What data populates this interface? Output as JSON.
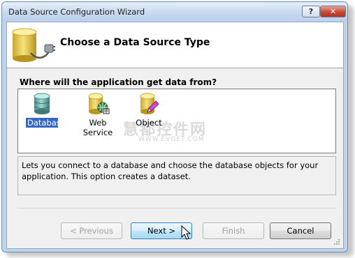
{
  "window": {
    "title": "Data Source Configuration Wizard"
  },
  "titlebar": {
    "help_label": "?",
    "close_label": "✕"
  },
  "header": {
    "title": "Choose a Data Source Type",
    "icon": "database-plug-icon"
  },
  "question": "Where will the application get data from?",
  "types": [
    {
      "label": "Database",
      "icon": "database-icon",
      "selected": true
    },
    {
      "label": "Web Service",
      "icon": "web-service-icon",
      "selected": false
    },
    {
      "label": "Object",
      "icon": "object-icon",
      "selected": false
    }
  ],
  "watermark": {
    "main": "慧都控件网",
    "sub": "WWW.EVGET.COM"
  },
  "description": "Lets you connect to a database and choose the database objects for your application. This option creates a dataset.",
  "buttons": {
    "previous": "< Previous",
    "next": "Next >",
    "finish": "Finish",
    "cancel": "Cancel"
  },
  "colors": {
    "selection": "#3168c6",
    "title_gradient_top": "#e4eefa",
    "close_red": "#c8493a"
  }
}
